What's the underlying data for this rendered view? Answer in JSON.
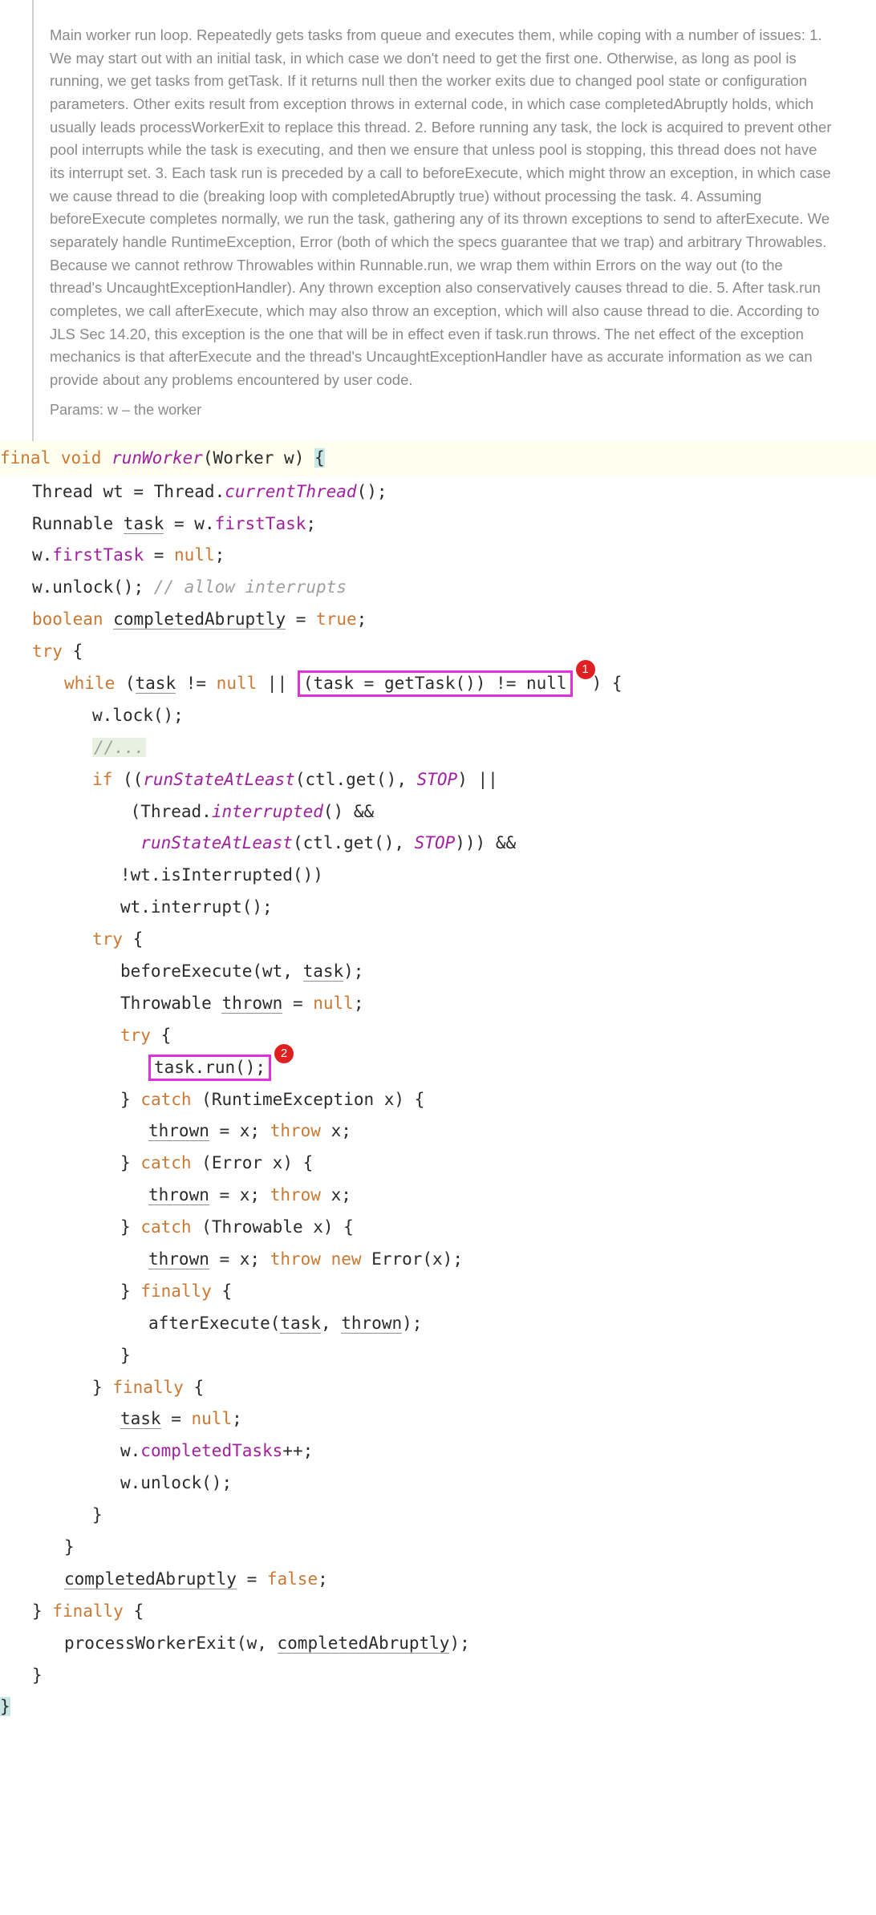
{
  "doc": {
    "comment": "Main worker run loop. Repeatedly gets tasks from queue and executes them, while coping with a number of issues: 1. We may start out with an initial task, in which case we don't need to get the first one. Otherwise, as long as pool is running, we get tasks from getTask. If it returns null then the worker exits due to changed pool state or configuration parameters. Other exits result from exception throws in external code, in which case completedAbruptly holds, which usually leads processWorkerExit to replace this thread. 2. Before running any task, the lock is acquired to prevent other pool interrupts while the task is executing, and then we ensure that unless pool is stopping, this thread does not have its interrupt set. 3. Each task run is preceded by a call to beforeExecute, which might throw an exception, in which case we cause thread to die (breaking loop with completedAbruptly true) without processing the task. 4. Assuming beforeExecute completes normally, we run the task, gathering any of its thrown exceptions to send to afterExecute. We separately handle RuntimeException, Error (both of which the specs guarantee that we trap) and arbitrary Throwables. Because we cannot rethrow Throwables within Runnable.run, we wrap them within Errors on the way out (to the thread's UncaughtExceptionHandler). Any thrown exception also conservatively causes thread to die. 5. After task.run completes, we call afterExecute, which may also throw an exception, which will also cause thread to die. According to JLS Sec 14.20, this exception is the one that will be in effect even if task.run throws. The net effect of the exception mechanics is that afterExecute and the thread's UncaughtExceptionHandler have as accurate information as we can provide about any problems encountered by user code.",
    "params_label": "Params:",
    "params_value": "w – the worker"
  },
  "code": {
    "kw_final": "final",
    "kw_void": "void",
    "fn_runWorker": "runWorker",
    "sig_rest": "(Worker w) ",
    "brace_open": "{",
    "brace_close": "}",
    "l_thread": "Thread wt = Thread.",
    "fn_currentThread": "currentThread",
    "paren_sc": "();",
    "l_runnable": "Runnable ",
    "task": "task",
    "eq_w": " = w.",
    "firstTask": "firstTask",
    "sc": ";",
    "l_w": "w.",
    "eq_null": " = ",
    "null": "null",
    "unlock": "unlock();",
    "c_allow": "// allow interrupts",
    "kw_boolean": "boolean",
    "completedAbruptly": "completedAbruptly",
    "eq": " = ",
    "true": "true",
    "false": "false",
    "kw_try": "try",
    "kw_while": "while",
    "while_cond_1": " (",
    "ne_null": " != ",
    "or": " || ",
    "hl1_text": "(task = getTask()) != null",
    "paren_close_brace": ") {",
    "lock": "lock();",
    "c_dots": "//...",
    "kw_if": "if",
    "if_open": " ((",
    "fn_runStateAtLeast": "runStateAtLeast",
    "ctl_get": "(ctl.get(), ",
    "STOP": "STOP",
    "close_or": ") ||",
    "open_thread": "(Thread.",
    "fn_interrupted": "interrupted",
    "close_and": "() &&",
    "close3_and": "))) &&",
    "not_wt": "!wt.isInterrupted())",
    "wt_interrupt": "wt.interrupt();",
    "before_pre": "beforeExecute(wt, ",
    "close_sc": ");",
    "throwable": "Throwable ",
    "thrown": "thrown",
    "hl2_text": "task.run();",
    "kw_catch": "catch",
    "catch_runtime": " (RuntimeException x) {",
    "catch_error": " (Error x) {",
    "catch_throwable": " (Throwable x) {",
    "thrown_x": " = x; ",
    "kw_throw": "throw",
    "x_sc": " x;",
    "kw_new": "new",
    "error_x": " Error(x);",
    "kw_finally": "finally",
    "after_pre": "afterExecute(",
    "comma": ", ",
    "task_null": " = ",
    "completedTasks": "completedTasks",
    "plusplus": "++;",
    "pwe_pre": "processWorkerExit(w, ",
    "badge1": "1",
    "badge2": "2"
  },
  "watermark": ""
}
